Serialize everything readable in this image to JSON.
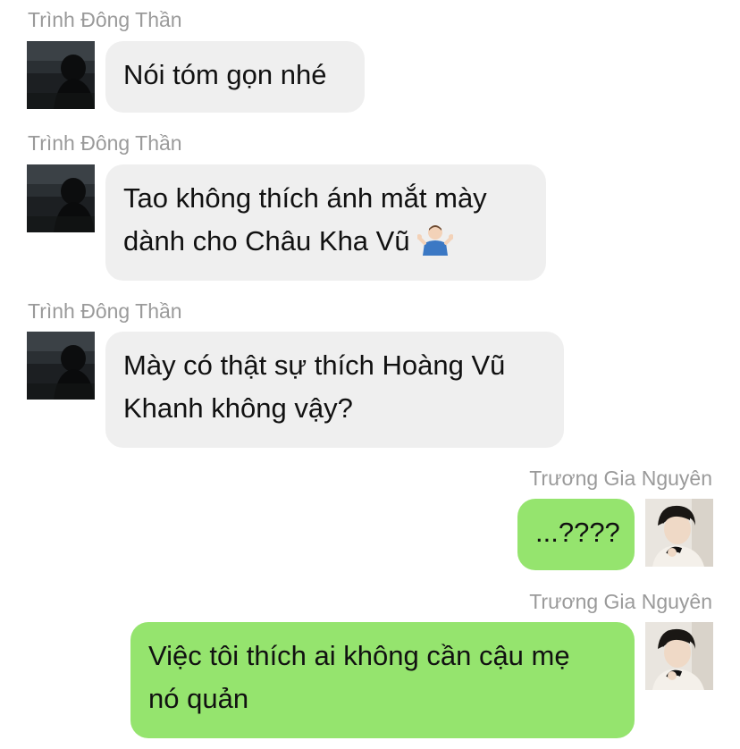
{
  "messages": [
    {
      "sender": "Trình Đông Thần",
      "lines": [
        "Nói tóm gọn nhé"
      ]
    },
    {
      "sender": "Trình Đông Thần",
      "lines": [
        "Tao không thích ánh mắt mày",
        "dành cho Châu Kha Vũ"
      ],
      "emoji": "person-shrugging-emoji"
    },
    {
      "sender": "Trình Đông Thần",
      "lines": [
        "Mày có thật sự thích Hoàng Vũ",
        "Khanh không vậy?"
      ]
    },
    {
      "sender": "Trương Gia Nguyên",
      "lines": [
        "...????"
      ]
    },
    {
      "sender": "Trương Gia Nguyên",
      "lines": [
        "Việc tôi thích ai không cần cậu mẹ",
        "nó quản"
      ]
    }
  ],
  "colors": {
    "incoming_bubble": "#efefef",
    "outgoing_bubble": "#95e46e",
    "sender_name": "#9a9a9a",
    "text": "#111111"
  }
}
